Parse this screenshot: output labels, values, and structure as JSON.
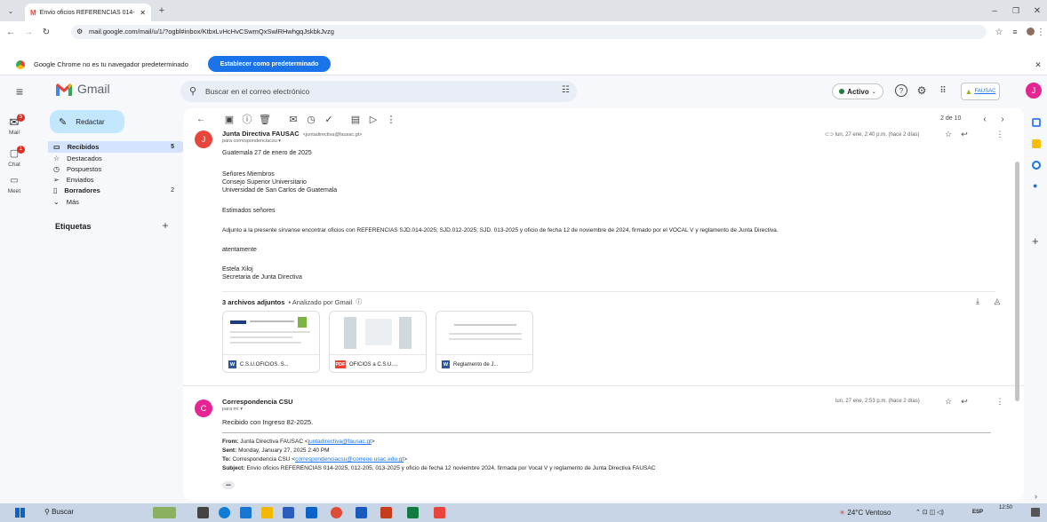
{
  "browser": {
    "tab_title": "Envio oficios REFERENCIAS 014-",
    "url": "mail.google.com/mail/u/1/?ogbl#inbox/KtbxLvHcHvCSwmQxSwlRHwhgqJskbkJvzg",
    "notification": "Google Chrome no es tu navegador predeterminado",
    "set_default": "Establecer como predeterminado"
  },
  "gmail": {
    "logo": "Gmail",
    "search_placeholder": "Buscar en el correo electrónico",
    "status": "Activo",
    "org_badge": "FAUSAC",
    "avatar": "J",
    "compose": "Redactar",
    "rail": {
      "mail": "Mail",
      "chat": "Chat",
      "meet": "Meet",
      "mail_badge": "5",
      "chat_badge": "1"
    },
    "nav": [
      {
        "label": "Recibidos",
        "count": "5",
        "bold": true
      },
      {
        "label": "Destacados",
        "count": ""
      },
      {
        "label": "Pospuestos",
        "count": ""
      },
      {
        "label": "Enviados",
        "count": ""
      },
      {
        "label": "Borradores",
        "count": "2",
        "bold": true
      },
      {
        "label": "Más",
        "count": ""
      }
    ],
    "labels_heading": "Etiquetas",
    "pager": "2 de 10"
  },
  "email1": {
    "avatar": "J",
    "sender": "Junta Directiva FAUSAC",
    "sender_email": "<juntadirectiva@fausac.gt>",
    "to": "para correspondenciacsu",
    "date": "lun, 27 ene, 2:40 p.m. (hace 2 días)",
    "body": [
      "Guatemala 27 de enero de 2025",
      "Señores Miembros",
      "Consejo Superior Universitario",
      "Universidad de San Carlos de Guatemala",
      "Estimados señores",
      "Adjunto a la presente sírvanse encontrar oficios con REFERENCIAS SJD.014-2025; SJD.012-2025; SJD. 013-2025 y oficio de fecha 12 de noviembre de 2024, firmado por el VOCAL V y reglamento de Junta Directiva.",
      "atentamente",
      "Estela Xiloj",
      "Secretaria de Junta Directiva"
    ],
    "attachments_heading": "3 archivos adjuntos",
    "scanned": "• Analizado por Gmail",
    "attachments": [
      {
        "name": "C.S.U.OFICIOS. S...",
        "type": "W",
        "color": "#2b579a"
      },
      {
        "name": "OFICIOS a C.S.U....",
        "type": "PDF",
        "color": "#ea4335"
      },
      {
        "name": "Reglamento de J...",
        "type": "W",
        "color": "#2b579a"
      }
    ]
  },
  "email2": {
    "avatar": "C",
    "sender": "Correspondencia CSU",
    "to": "para mí",
    "date": "lun, 27 ene, 2:53 p.m. (hace 2 días)",
    "body": "Recibido con Ingreso 82-2025.",
    "from_label": "From:",
    "from": "Junta Directiva FAUSAC <",
    "from_link": "juntadirectiva@fausac.gt",
    "from_end": ">",
    "sent_label": "Sent:",
    "sent": "Monday, January 27, 2025 2:40 PM",
    "to_label": "To:",
    "to_val": "Correspondencia CSU <",
    "to_link": "correspondenciacsu@correoe.usac.edu.gt",
    "to_end": ">",
    "subject_label": "Subject:",
    "subject": "Envio oficios REFERENCIAS 014-2025, 012-205, 013-2025 y oficio de fecha 12 noviembre 2024, firmada por Vocal V y reglamento de Junta Directiva FAUSAC",
    "more": "•••"
  },
  "taskbar": {
    "search": "Buscar",
    "weather": "24°C Ventoso",
    "lang": "ESP",
    "time": "12:50"
  }
}
